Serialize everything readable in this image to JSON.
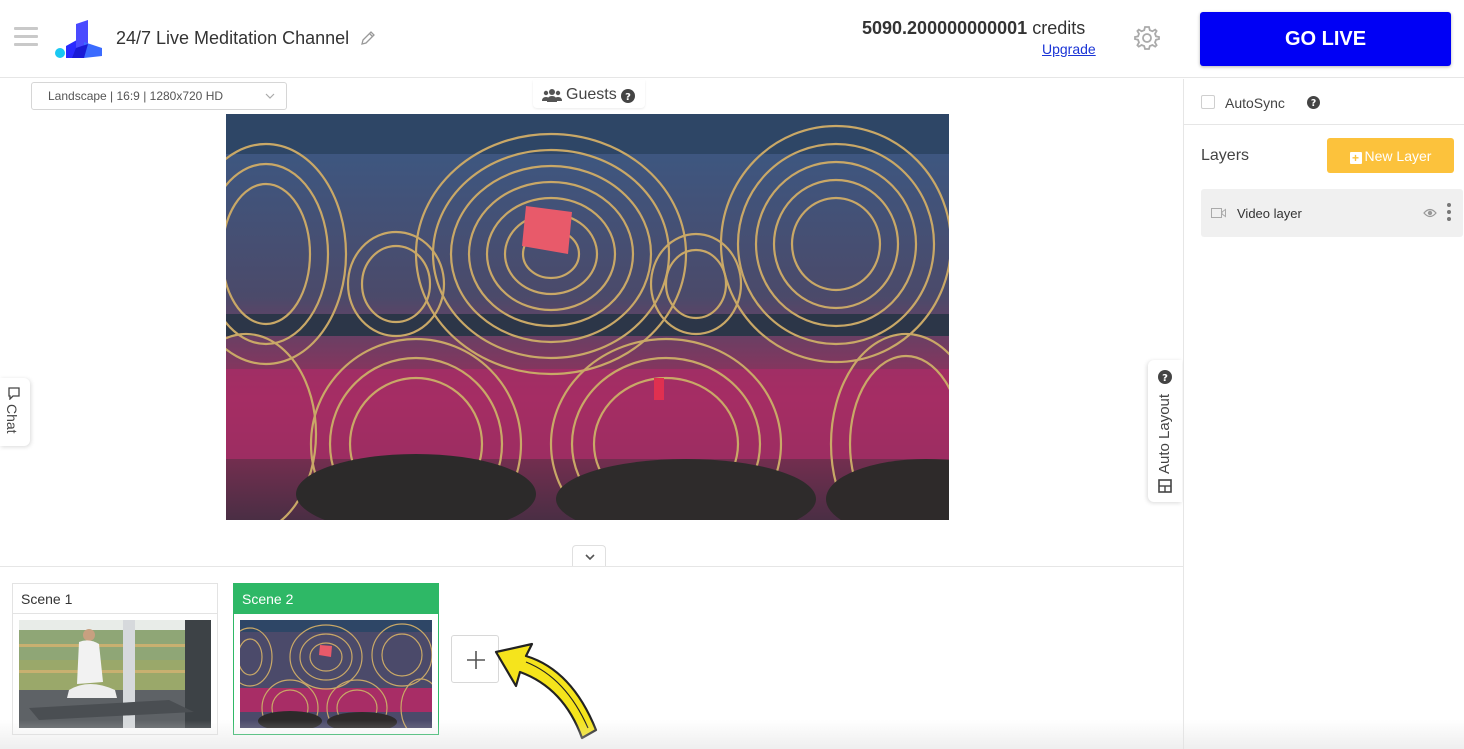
{
  "header": {
    "channel_title": "24/7 Live Meditation Channel",
    "credits_amount": "5090.200000000001",
    "credits_unit": "credits",
    "upgrade_label": "Upgrade",
    "go_live_label": "GO LIVE"
  },
  "stage": {
    "resolution_value": "Landscape | 16:9 | 1280x720 HD",
    "guests_label": "Guests",
    "chat_label": "Chat",
    "auto_layout_label": "Auto Layout"
  },
  "scenes": {
    "items": [
      {
        "label": "Scene 1",
        "active": false
      },
      {
        "label": "Scene 2",
        "active": true
      }
    ]
  },
  "right_panel": {
    "autosync_label": "AutoSync",
    "autosync_checked": false,
    "layers_title": "Layers",
    "new_layer_label": "New Layer",
    "layers": [
      {
        "name": "Video layer"
      }
    ]
  },
  "colors": {
    "go_live": "#0000f5",
    "new_layer": "#fcc23c",
    "active_scene": "#2eb866",
    "link": "#1a34d6",
    "arrow": "#f5e41c"
  }
}
